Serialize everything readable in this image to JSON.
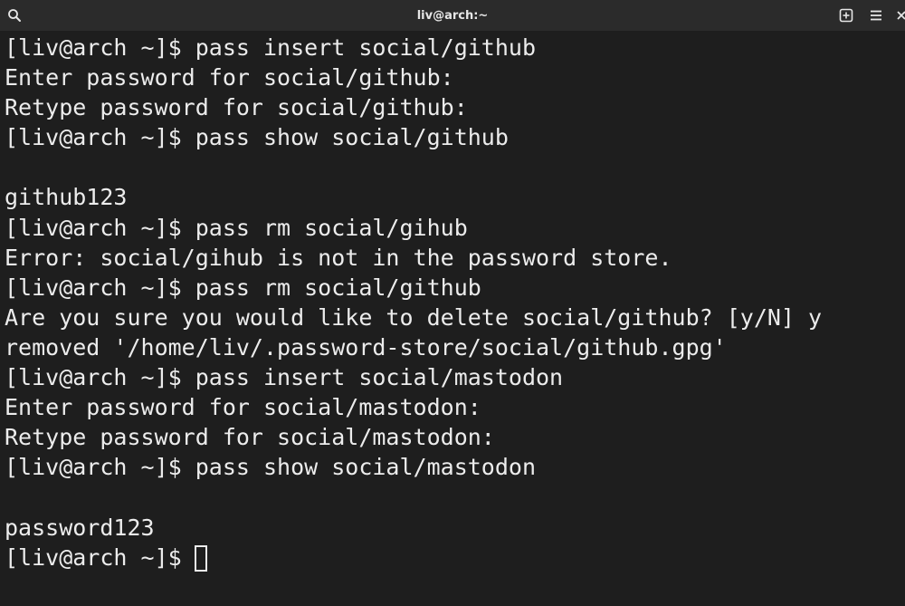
{
  "window": {
    "title": "liv@arch:~",
    "colors": {
      "titlebar_bg": "#2b2b2b",
      "terminal_bg": "#1e1e1e",
      "text": "#ececec"
    }
  },
  "titlebar": {
    "left_icon": "search-icon",
    "right_icons": [
      "new-tab-icon",
      "hamburger-menu-icon",
      "close-icon"
    ]
  },
  "terminal": {
    "lines": [
      "[liv@arch ~]$ pass insert social/github",
      "Enter password for social/github:",
      "Retype password for social/github:",
      "[liv@arch ~]$ pass show social/github",
      "",
      "github123",
      "[liv@arch ~]$ pass rm social/gihub",
      "Error: social/gihub is not in the password store.",
      "[liv@arch ~]$ pass rm social/github",
      "Are you sure you would like to delete social/github? [y/N] y",
      "removed '/home/liv/.password-store/social/github.gpg'",
      "[liv@arch ~]$ pass insert social/mastodon",
      "Enter password for social/mastodon:",
      "Retype password for social/mastodon:",
      "[liv@arch ~]$ pass show social/mastodon",
      "",
      "password123"
    ],
    "prompt": "[liv@arch ~]$"
  }
}
